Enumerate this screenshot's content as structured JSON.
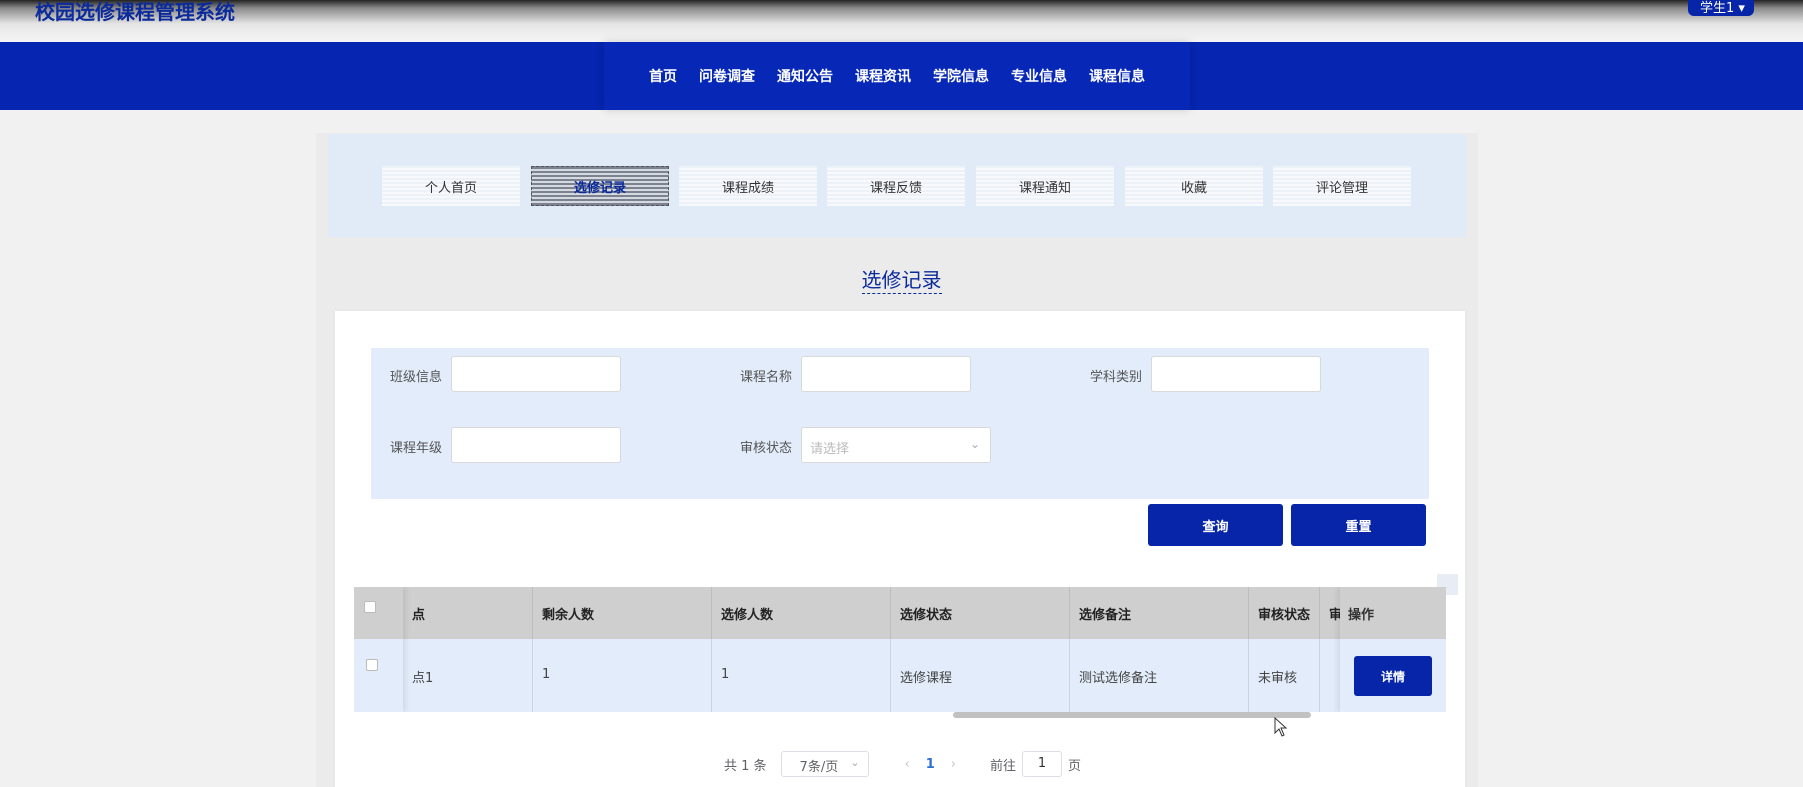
{
  "header": {
    "title": "校园选修课程管理系统",
    "user": "学生1 ▾"
  },
  "nav": [
    "首页",
    "问卷调查",
    "通知公告",
    "课程资讯",
    "学院信息",
    "专业信息",
    "课程信息"
  ],
  "tabs": [
    "个人首页",
    "选修记录",
    "课程成绩",
    "课程反馈",
    "课程通知",
    "收藏",
    "评论管理"
  ],
  "active_tab": "选修记录",
  "page_title": "选修记录",
  "filters": {
    "class_label": "班级信息",
    "course_label": "课程名称",
    "subject_label": "学科类别",
    "grade_label": "课程年级",
    "audit_label": "审核状态",
    "audit_placeholder": "请选择"
  },
  "buttons": {
    "query": "查询",
    "reset": "重置",
    "detail": "详情"
  },
  "table": {
    "columns": [
      "点",
      "剩余人数",
      "选修人数",
      "选修状态",
      "选修备注",
      "审核状态",
      "审",
      "操作"
    ],
    "rows": [
      [
        "点1",
        "1",
        "1",
        "选修课程",
        "测试选修备注",
        "未审核"
      ]
    ]
  },
  "pagination": {
    "total": "共 1 条",
    "page_size": "7条/页",
    "current": "1",
    "goto": "前往",
    "page_value": "1",
    "page_unit": "页"
  }
}
